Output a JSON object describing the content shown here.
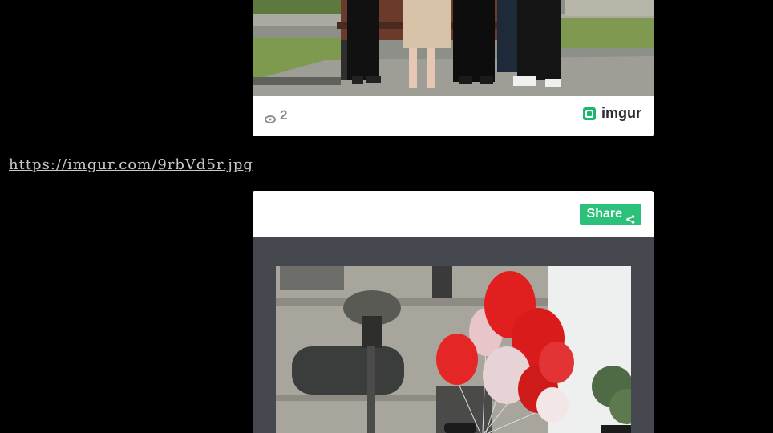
{
  "post1": {
    "view_count": "2",
    "brand": "imgur",
    "photo_alt": "Group photo of people standing near a bench"
  },
  "link": {
    "url": "https://imgur.com/9rbVd5r.jpg"
  },
  "post2": {
    "share_label": "Share",
    "photo_alt": "Red and white balloons near a street lamp and building"
  },
  "colors": {
    "background": "#000000",
    "share_green": "#2cc17b",
    "embed_dark": "#45494f"
  }
}
